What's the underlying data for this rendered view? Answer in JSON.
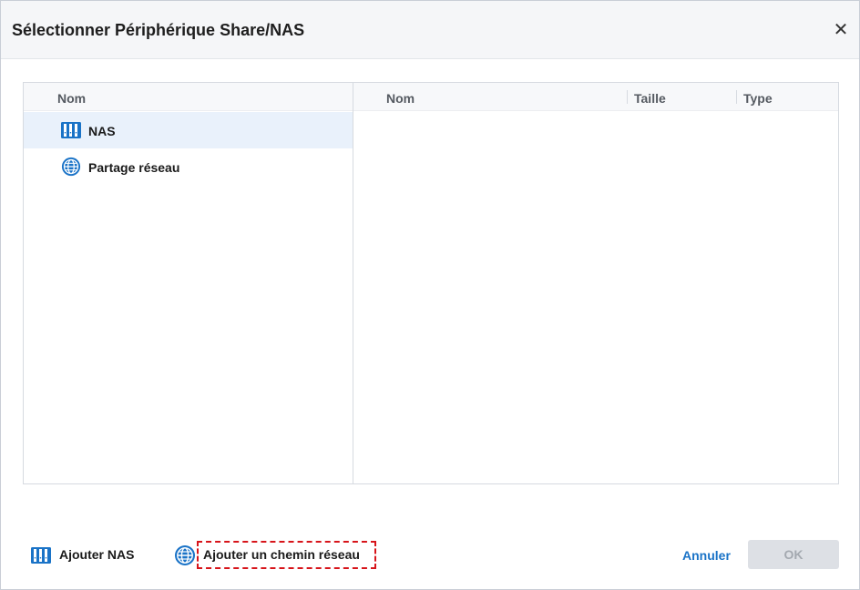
{
  "dialog": {
    "title": "Sélectionner Périphérique Share/NAS",
    "close_icon": "close-icon"
  },
  "left_pane": {
    "header": "Nom",
    "items": [
      {
        "label": "NAS",
        "icon": "nas-icon",
        "selected": true
      },
      {
        "label": "Partage réseau",
        "icon": "globe-icon",
        "selected": false
      }
    ]
  },
  "right_pane": {
    "columns": [
      "Nom",
      "Taille",
      "Type"
    ]
  },
  "footer": {
    "add_nas_label": "Ajouter NAS",
    "add_network_path_label": "Ajouter un chemin réseau",
    "cancel_label": "Annuler",
    "ok_label": "OK",
    "ok_disabled": true
  },
  "colors": {
    "accent": "#1a73c7",
    "selection": "#e9f1fb",
    "highlight_border": "#d7141a",
    "disabled_button": "#dde0e5"
  }
}
